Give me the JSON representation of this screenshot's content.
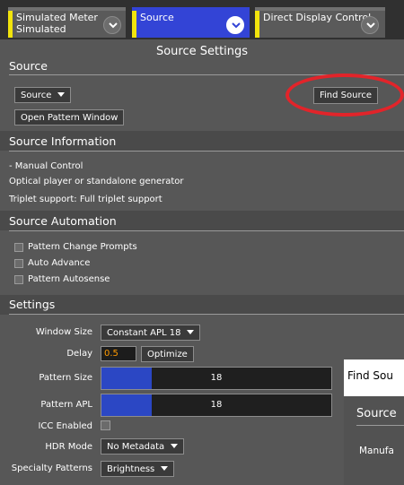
{
  "tabs": [
    {
      "line1": "Simulated Meter",
      "line2": "Simulated"
    },
    {
      "line1": "Source",
      "line2": ""
    },
    {
      "line1": "Direct Display Control",
      "line2": ""
    }
  ],
  "panel_title": "Source Settings",
  "source_section": {
    "title": "Source",
    "source_dropdown": "Source",
    "find_source_button": "Find Source",
    "open_pattern_button": "Open Pattern Window"
  },
  "source_info": {
    "title": "Source Information",
    "line1": "- Manual Control",
    "line2": "Optical player or standalone generator",
    "line3": "Triplet support: Full triplet support"
  },
  "automation": {
    "title": "Source Automation",
    "items": [
      "Pattern Change Prompts",
      "Auto Advance",
      "Pattern Autosense"
    ]
  },
  "settings": {
    "title": "Settings",
    "window_size_label": "Window Size",
    "window_size_value": "Constant APL 18",
    "delay_label": "Delay",
    "delay_value": "0.5",
    "optimize_button": "Optimize",
    "pattern_size_label": "Pattern Size",
    "pattern_size_value": "18",
    "pattern_size_fraction": 0.22,
    "pattern_apl_label": "Pattern APL",
    "pattern_apl_value": "18",
    "pattern_apl_fraction": 0.22,
    "icc_label": "ICC Enabled",
    "hdr_label": "HDR Mode",
    "hdr_value": "No Metadata",
    "specialty_label": "Specialty Patterns",
    "specialty_value": "Brightness"
  },
  "popup": {
    "title": "Find Sou",
    "section": "Source",
    "text": "Manufa"
  },
  "colors": {
    "accent_tab": "#3344d6",
    "tab_strip": "#f2e40c",
    "annotation": "#e2242a",
    "slider_fill": "#2b47c4",
    "delay_text": "#ff9a00"
  }
}
